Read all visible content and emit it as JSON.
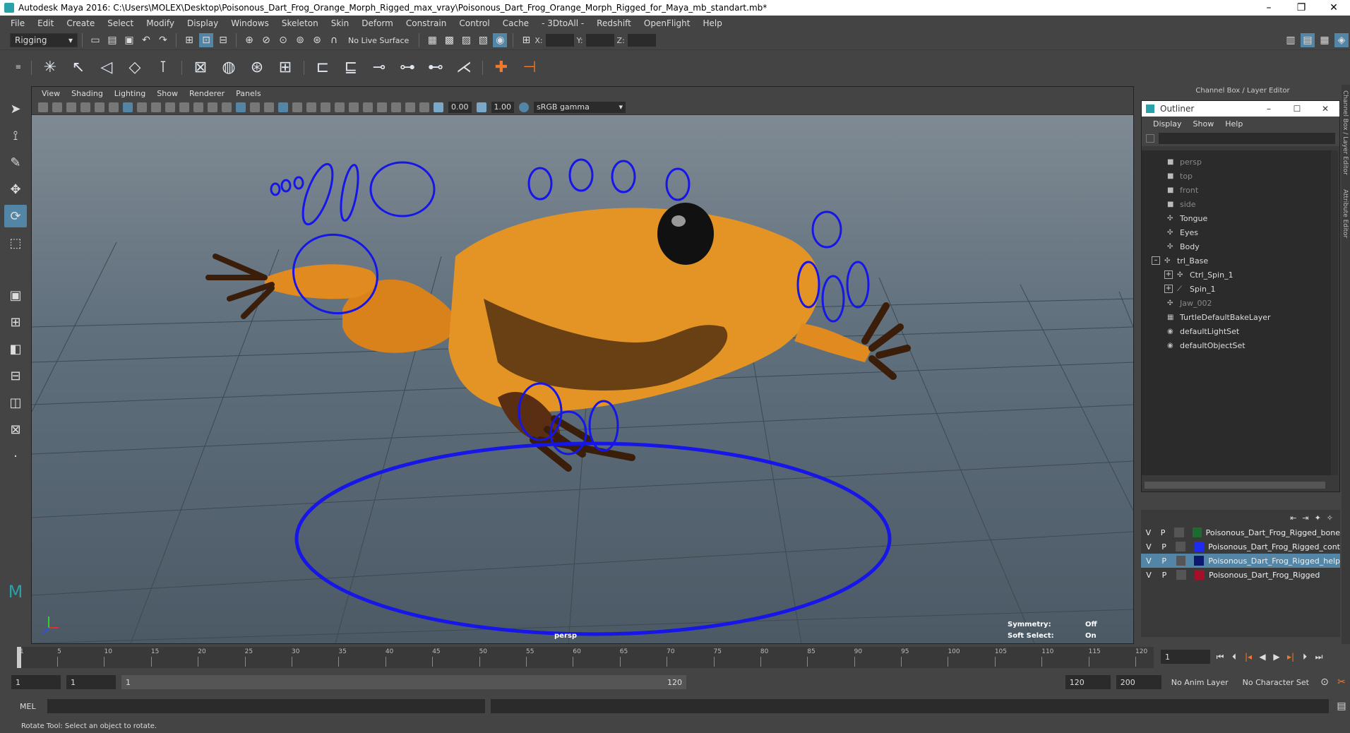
{
  "window": {
    "title": "Autodesk Maya 2016: C:\\Users\\MOLEX\\Desktop\\Poisonous_Dart_Frog_Orange_Morph_Rigged_max_vray\\Poisonous_Dart_Frog_Orange_Morph_Rigged_for_Maya_mb_standart.mb*",
    "minimize": "–",
    "restore": "❐",
    "close": "✕"
  },
  "menubar": [
    "File",
    "Edit",
    "Create",
    "Select",
    "Modify",
    "Display",
    "Windows",
    "Skeleton",
    "Skin",
    "Deform",
    "Constrain",
    "Control",
    "Cache",
    "- 3DtoAll -",
    "Redshift",
    "OpenFlight",
    "Help"
  ],
  "statusline": {
    "menuset": "Rigging",
    "live_surface": "No Live Surface",
    "x_label": "X:",
    "y_label": "Y:",
    "z_label": "Z:"
  },
  "viewport": {
    "menu": [
      "View",
      "Shading",
      "Lighting",
      "Show",
      "Renderer",
      "Panels"
    ],
    "near_value": "0.00",
    "far_value": "1.00",
    "color_space": "sRGB gamma",
    "camera_label": "persp",
    "symmetry_label": "Symmetry:",
    "symmetry_value": "Off",
    "softselect_label": "Soft Select:",
    "softselect_value": "On"
  },
  "right_panel": {
    "header": "Channel Box / Layer Editor",
    "side_tab_1": "Channel Box / Layer Editor",
    "side_tab_2": "Attribute Editor",
    "outliner": {
      "title": "Outliner",
      "menu": [
        "Display",
        "Show",
        "Help"
      ],
      "items": [
        {
          "label": "persp",
          "dim": true,
          "icon": "camera-icon",
          "indent": 0
        },
        {
          "label": "top",
          "dim": true,
          "icon": "camera-icon",
          "indent": 0
        },
        {
          "label": "front",
          "dim": true,
          "icon": "camera-icon",
          "indent": 0
        },
        {
          "label": "side",
          "dim": true,
          "icon": "camera-icon",
          "indent": 0
        },
        {
          "label": "Tongue",
          "dim": false,
          "icon": "mesh-icon",
          "indent": 0
        },
        {
          "label": "Eyes",
          "dim": false,
          "icon": "mesh-icon",
          "indent": 0
        },
        {
          "label": "Body",
          "dim": false,
          "icon": "mesh-icon",
          "indent": 0
        },
        {
          "label": "trl_Base",
          "dim": false,
          "icon": "curve-icon",
          "indent": 0,
          "expand": "–"
        },
        {
          "label": "Ctrl_Spin_1",
          "dim": false,
          "icon": "curve-icon",
          "indent": 1,
          "expand": "+"
        },
        {
          "label": "Spin_1",
          "dim": false,
          "icon": "joint-icon",
          "indent": 1,
          "expand": "+"
        },
        {
          "label": "Jaw_002",
          "dim": true,
          "icon": "mesh-icon",
          "indent": 0
        },
        {
          "label": "TurtleDefaultBakeLayer",
          "dim": false,
          "icon": "layer-icon",
          "indent": 0
        },
        {
          "label": "defaultLightSet",
          "dim": false,
          "icon": "set-icon",
          "indent": 0
        },
        {
          "label": "defaultObjectSet",
          "dim": false,
          "icon": "set-icon",
          "indent": 0
        }
      ]
    },
    "layers": [
      {
        "v": "V",
        "p": "P",
        "color": "#1c6b2f",
        "name": "Poisonous_Dart_Frog_Rigged_bone",
        "selected": false
      },
      {
        "v": "V",
        "p": "P",
        "color": "#1f2cf0",
        "name": "Poisonous_Dart_Frog_Rigged_cont",
        "selected": false
      },
      {
        "v": "V",
        "p": "P",
        "color": "#0b1a6e",
        "name": "Poisonous_Dart_Frog_Rigged_help",
        "selected": true
      },
      {
        "v": "V",
        "p": "P",
        "color": "#a3102a",
        "name": "Poisonous_Dart_Frog_Rigged",
        "selected": false
      }
    ]
  },
  "timeslider": {
    "ticks": [
      "1",
      "5",
      "10",
      "15",
      "20",
      "25",
      "30",
      "35",
      "40",
      "45",
      "50",
      "55",
      "60",
      "65",
      "70",
      "75",
      "80",
      "85",
      "90",
      "95",
      "100",
      "105",
      "110",
      "115",
      "120"
    ],
    "current_frame": "1"
  },
  "range": {
    "start": "1",
    "playback_start": "1",
    "range_start": "1",
    "range_end": "120",
    "playback_end": "120",
    "end": "200",
    "anim_layer": "No Anim Layer",
    "character_set": "No Character Set"
  },
  "command": {
    "language": "MEL"
  },
  "helpline": "Rotate Tool: Select an object to rotate."
}
